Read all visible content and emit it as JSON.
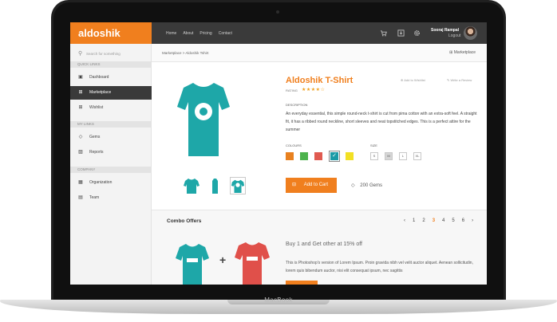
{
  "device": {
    "brand": "MacBook"
  },
  "app": {
    "logo": "aldoshik"
  },
  "topnav": {
    "items": [
      "Home",
      "About",
      "Pricing",
      "Contact"
    ]
  },
  "user": {
    "name": "Sooraj Rampal",
    "logout": "Logout"
  },
  "sidebar": {
    "search_placeholder": "Search for something",
    "sections": [
      {
        "title": "QUICK LINKS",
        "items": [
          {
            "label": "Dashboard",
            "icon": "dashboard-icon"
          },
          {
            "label": "Marketplace",
            "icon": "cart-icon",
            "active": true
          },
          {
            "label": "Wishlist",
            "icon": "plus-box-icon"
          }
        ]
      },
      {
        "title": "MY LINKS",
        "items": [
          {
            "label": "Gems",
            "icon": "diamond-icon"
          },
          {
            "label": "Reports",
            "icon": "chart-icon"
          }
        ]
      },
      {
        "title": "COMPANY",
        "items": [
          {
            "label": "Organization",
            "icon": "building-icon"
          },
          {
            "label": "Team",
            "icon": "team-icon"
          }
        ]
      }
    ]
  },
  "breadcrumb": {
    "text": "Marketplace  >  Aldoshik Tshirt",
    "page_label": "Marketplace"
  },
  "product": {
    "title": "Aldoshik T-Shirt",
    "rating_label": "RATING",
    "rating_stars": "★★★★☆",
    "rating": 4,
    "add_to_wishlist": "Add to Wishlist",
    "write_review": "Write a Review",
    "description_label": "DESCRIPTION",
    "description": "An everyday essential, this simple round-neck t-shirt is cut from pima cotton with an extra-soft feel. A straight fit, it has a ribbed round neckline, short sleeves and neat topstitched edges. This is a perfect attire for the summer",
    "colours_label": "COLOURS",
    "colours": [
      "#e8811f",
      "#4cb24c",
      "#e05a50",
      "#1b9aa6",
      "#f2e024"
    ],
    "selected_colour_index": 3,
    "size_label": "SIZE",
    "sizes": [
      "S",
      "M",
      "L",
      "XL"
    ],
    "selected_size_index": 1,
    "add_to_cart": "Add to Cart",
    "gems": "200 Gems",
    "shirt_color": "#1ea7a8"
  },
  "combo": {
    "title": "Combo Offers",
    "pages": [
      "1",
      "2",
      "3",
      "4",
      "5",
      "6"
    ],
    "current_page": "3",
    "offer": "Buy 1 and Get other at 15% off",
    "description": "This is Photoshop's version  of Lorem Ipsum. Proin gravida nibh vel velit auctor aliquet. Aenean sollicitudin, lorem quis bibendum auctor, nisi elit consequat ipsum, nec sagittis",
    "shirt_colors": [
      "#1ea7a8",
      "#e0504a"
    ]
  }
}
